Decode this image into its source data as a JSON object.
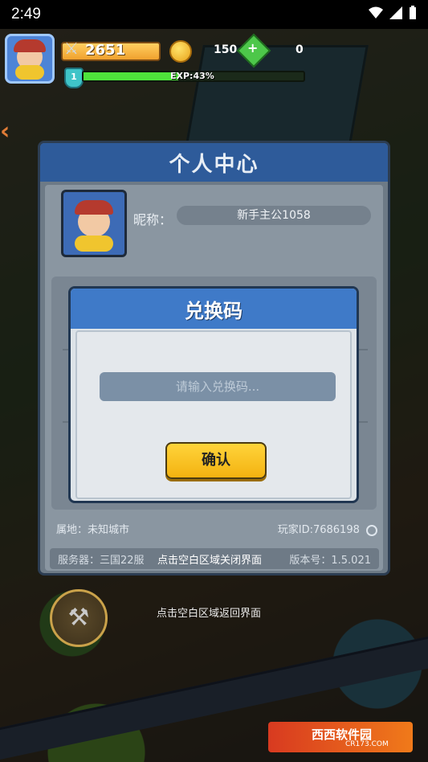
{
  "status_bar": {
    "time": "2:49"
  },
  "hud": {
    "power": "2651",
    "coins": "150",
    "gems": "0",
    "level": "1",
    "exp_label": "EXP:43%",
    "exp_progress": 0.43
  },
  "profile_panel": {
    "title": "个人中心",
    "nickname_label": "昵称：",
    "nickname": "新手主公1058",
    "location": "属地：未知城市",
    "player_id": "玩家ID:7686198",
    "server": "服务器：三国22服",
    "version": "版本号：1.5.021",
    "close_hint": "点击空白区域关闭界面"
  },
  "redeem_dialog": {
    "title": "兑换码",
    "input_placeholder": "请输入兑换码...",
    "input_value": "",
    "confirm_label": "确认"
  },
  "return_hint": "点击空白区域返回界面",
  "watermark": {
    "text": "西西软件园",
    "url": "CR173.COM"
  },
  "colors": {
    "panel_header": "#2e5b9a",
    "dialog_header": "#3f7ac8",
    "confirm_button": "#ffd43b",
    "exp_fill": "#4ee23b"
  }
}
